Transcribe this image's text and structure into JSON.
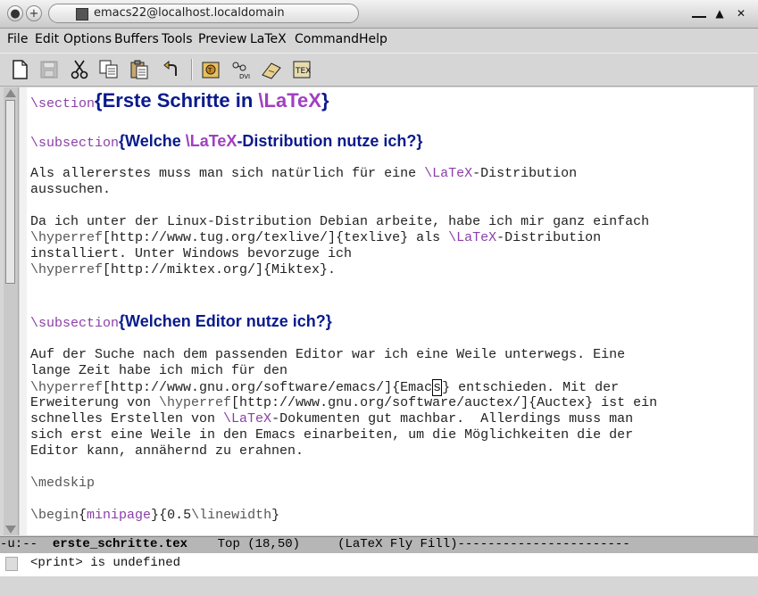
{
  "window": {
    "title": "emacs22@localhost.localdomain",
    "controls": [
      "▁",
      "▲",
      "✕"
    ]
  },
  "menubar": {
    "items": [
      "File",
      "Edit",
      "Options",
      "Buffers",
      "Tools",
      "Preview",
      "LaTeX",
      "Command",
      "Help"
    ]
  },
  "toolbar": {
    "icons": [
      "new-file",
      "save",
      "cut",
      "copy",
      "paste",
      "undo",
      "latex",
      "dvi",
      "view",
      "tex-file"
    ]
  },
  "editor": {
    "section_cmd": "\\section",
    "section_title_pre": "Erste Schritte in ",
    "section_title_cmd": "\\LaTeX",
    "sub1_cmd": "\\subsection",
    "sub1_pre": "Welche ",
    "sub1_cmd2": "\\LaTeX",
    "sub1_post": "-Distribution nutze ich?",
    "p1_l1_a": "Als allererstes muss man sich natürlich für eine ",
    "p1_l1_cmd": "\\LaTeX",
    "p1_l1_b": "-Distribution",
    "p1_l2": "aussuchen.",
    "p2_l1": "Da ich unter der Linux-Distribution Debian arbeite, habe ich mir ganz einfach",
    "p2_l2_cmd": "\\hyperref",
    "p2_l2_a": "[http://www.tug.org/texlive/]{texlive} als ",
    "p2_l2_cmd2": "\\LaTeX",
    "p2_l2_b": "-Distribution",
    "p2_l3": "installiert. Unter Windows bevorzuge ich",
    "p2_l4_cmd": "\\hyperref",
    "p2_l4": "[http://miktex.org/]{Miktex}.",
    "sub2_cmd": "\\subsection",
    "sub2_title": "Welchen Editor nutze ich?",
    "p3_l1": "Auf der Suche nach dem passenden Editor war ich eine Weile unterwegs. Eine",
    "p3_l2": "lange Zeit habe ich mich für den",
    "p3_l3_cmd": "\\hyperref",
    "p3_l3_a": "[http://www.gnu.org/software/emacs/]{Emac",
    "p3_l3_cursor": "s",
    "p3_l3_b": "} entschieden. Mit der",
    "p3_l4_a": "Erweiterung von ",
    "p3_l4_cmd": "\\hyperref",
    "p3_l4_b": "[http://www.gnu.org/software/auctex/]{Auctex} ist ein",
    "p3_l5_a": "schnelles Erstellen von ",
    "p3_l5_cmd": "\\LaTeX",
    "p3_l5_b": "-Dokumenten gut machbar.  Allerdings muss man",
    "p3_l6": "sich erst eine Weile in den Emacs einarbeiten, um die Möglichkeiten die der",
    "p3_l7": "Editor kann, annähernd zu erahnen.",
    "medskip": "\\medskip",
    "begin_cmd": "\\begin",
    "begin_open": "{",
    "begin_env": "minipage",
    "begin_close": "}",
    "begin_arg_a": "{0.5",
    "begin_arg_cmd": "\\linewidth",
    "begin_arg_b": "}"
  },
  "modeline": {
    "left": "-u:--  ",
    "buffer": "erste_schritte.tex",
    "pos": "    Top (18,50)     ",
    "mode": "(LaTeX Fly Fill)",
    "fill": "-----------------------"
  },
  "echo": {
    "message": "<print> is undefined"
  }
}
